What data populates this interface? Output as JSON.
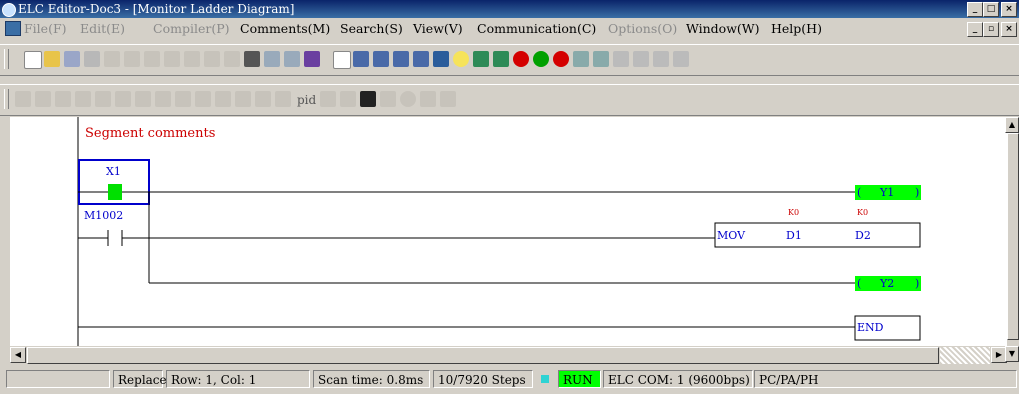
{
  "window": {
    "title": "ELC Editor-Doc3 - [Monitor Ladder Diagram]",
    "controls": [
      "_",
      "□",
      "×"
    ],
    "doc_controls": [
      "_",
      "▫",
      "×"
    ]
  },
  "menu": [
    {
      "label": "File(F)",
      "enabled": false
    },
    {
      "label": "Edit(E)",
      "enabled": false
    },
    {
      "label": "Compiler(P)",
      "enabled": false
    },
    {
      "label": "Comments(M)",
      "enabled": true
    },
    {
      "label": "Search(S)",
      "enabled": true
    },
    {
      "label": "View(V)",
      "enabled": true
    },
    {
      "label": "Communication(C)",
      "enabled": true
    },
    {
      "label": "Options(O)",
      "enabled": false
    },
    {
      "label": "Window(W)",
      "enabled": true
    },
    {
      "label": "Help(H)",
      "enabled": true
    }
  ],
  "toolbar2": {
    "pid_label": "pid"
  },
  "ladder": {
    "segment_comment": "Segment comments",
    "x1": "X1",
    "m1002": "M1002",
    "y1": "Y1",
    "y2": "Y2",
    "mov": "MOV",
    "d1": "D1",
    "d2": "D2",
    "k0a": "K0",
    "k0b": "K0",
    "end": "END",
    "open_paren": "(",
    "close_paren": ")"
  },
  "status": {
    "mode": "Replace",
    "rowcol": "Row: 1, Col: 1",
    "scan": "Scan time: 0.8ms",
    "steps": "10/7920 Steps",
    "run": "RUN",
    "comm": "ELC COM: 1  (9600bps)",
    "model": "PC/PA/PH"
  },
  "colors": {
    "accent_green": "#00ff00",
    "comment_red": "#cc0000",
    "instr_blue": "#0000cc"
  }
}
